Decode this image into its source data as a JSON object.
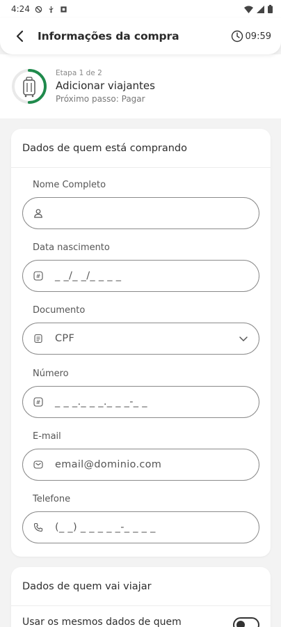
{
  "status_bar": {
    "time": "4:24"
  },
  "header": {
    "title": "Informações da compra",
    "timer": "09:59"
  },
  "step": {
    "label": "Etapa 1 de 2",
    "title": "Adicionar viajantes",
    "next": "Próximo passo: Pagar",
    "progress": 0.5,
    "accent_color": "#1f8a4c"
  },
  "buyer": {
    "title": "Dados de quem está comprando",
    "fields": [
      {
        "label": "Nome Completo",
        "value": "",
        "icon": "person-icon"
      },
      {
        "label": "Data nascimento",
        "value": "_ _/_ _/_ _ _ _",
        "icon": "hash-icon"
      },
      {
        "label": "Documento",
        "value": "CPF",
        "icon": "document-icon"
      },
      {
        "label": "Número",
        "value": "_ _ _._ _ _._ _ _-_ _",
        "icon": "hash-icon"
      },
      {
        "label": "E-mail",
        "value": "email@dominio.com",
        "icon": "mail-icon"
      },
      {
        "label": "Telefone",
        "value": "(_ _) _ _ _ _ _-_ _ _ _",
        "icon": "phone-icon"
      }
    ]
  },
  "traveler": {
    "title": "Dados de quem vai viajar",
    "same_data_text": "Usar os mesmos dados de quem"
  }
}
